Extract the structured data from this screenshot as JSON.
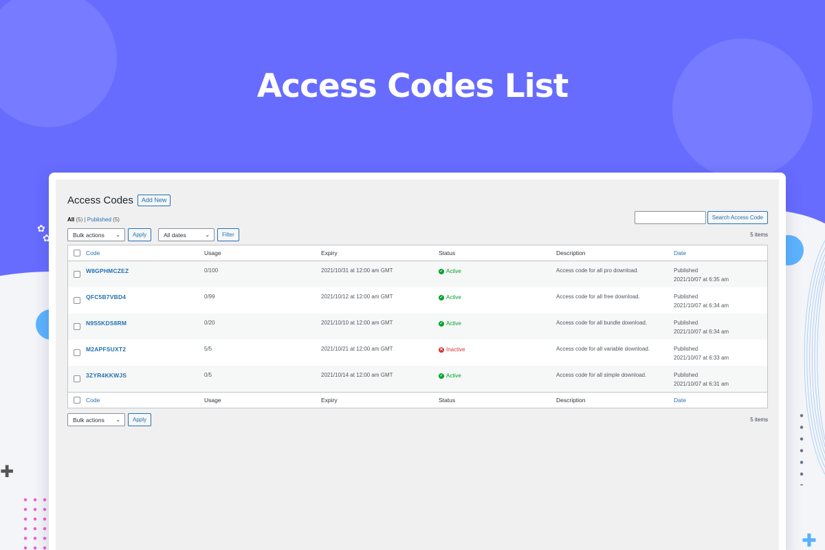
{
  "banner": {
    "title": "Access Codes List"
  },
  "colors": {
    "hero": "#676cff",
    "link": "#2271b1",
    "active": "#00a32a",
    "inactive": "#d63638"
  },
  "header": {
    "title": "Access Codes",
    "add_new": "Add New"
  },
  "views": {
    "all_label": "All",
    "all_count": "(5)",
    "separator": "|",
    "published_label": "Published",
    "published_count": "(5)"
  },
  "search": {
    "button": "Search Access Code",
    "value": ""
  },
  "toolbar": {
    "bulk_actions": "Bulk actions",
    "apply": "Apply",
    "all_dates": "All dates",
    "filter": "Filter",
    "items_count": "5 items"
  },
  "columns": {
    "code": "Code",
    "usage": "Usage",
    "expiry": "Expiry",
    "status": "Status",
    "description": "Description",
    "date": "Date"
  },
  "rows": [
    {
      "code": "W8GPHMCZEZ",
      "usage": "0/100",
      "expiry": "2021/10/31 at 12:00 am GMT",
      "status": "Active",
      "status_icon": "check-circle-icon",
      "description": "Access code for all pro download.",
      "date_status": "Published",
      "date": "2021/10/07 at 6:35 am"
    },
    {
      "code": "QFC5B7VBD4",
      "usage": "0/99",
      "expiry": "2021/10/12 at 12:00 am GMT",
      "status": "Active",
      "status_icon": "check-circle-icon",
      "description": "Access code for all free download.",
      "date_status": "Published",
      "date": "2021/10/07 at 6:34 am"
    },
    {
      "code": "N9S5KDS8RM",
      "usage": "0/20",
      "expiry": "2021/10/10 at 12:00 am GMT",
      "status": "Active",
      "status_icon": "check-circle-icon",
      "description": "Access code for all bundle download.",
      "date_status": "Published",
      "date": "2021/10/07 at 6:34 am"
    },
    {
      "code": "M2APFSUXT2",
      "usage": "5/5",
      "expiry": "2021/10/21 at 12:00 am GMT",
      "status": "Inactive",
      "status_icon": "x-circle-icon",
      "description": "Access code for all variable download.",
      "date_status": "Published",
      "date": "2021/10/07 at 6:33 am"
    },
    {
      "code": "3ZYR4KKWJS",
      "usage": "0/5",
      "expiry": "2021/10/14 at 12:00 am GMT",
      "status": "Active",
      "status_icon": "check-circle-icon",
      "description": "Access code for all simple download.",
      "date_status": "Published",
      "date": "2021/10/07 at 6:31 am"
    }
  ]
}
